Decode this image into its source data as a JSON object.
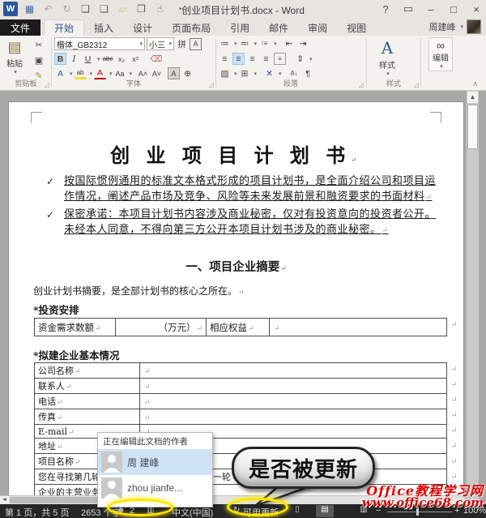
{
  "window": {
    "title": "创业项目计划书.docx - Word",
    "user_name": "周建峰",
    "help": "?"
  },
  "icons": {
    "word_logo": "W",
    "save": "▦",
    "undo": "↶",
    "redo": "↻",
    "quick_print": "❑",
    "new_doc": "❏",
    "open": "▱",
    "print_preview": "❒",
    "touch_mode": "☝",
    "ribbon_options": "▭",
    "minimize": "–",
    "restore": "□",
    "close": "×",
    "dropdown": "▾",
    "launcher": "◿",
    "collapse": "∧",
    "paste": "▤",
    "cut": "✂",
    "copy": "▣",
    "format_painter": "✎",
    "phonetic": "拼",
    "char_border": "A",
    "bold": "B",
    "italic": "I",
    "underline": "U",
    "strike": "abc",
    "subscript": "x₂",
    "superscript": "x²",
    "clear_format": "⌫",
    "text_effects": "A",
    "highlight": "ab",
    "font_color": "A",
    "change_case": "Aa",
    "grow_font": "A˄",
    "shrink_font": "A˅",
    "char_shading": "A",
    "enclose_char": "⊕",
    "bullets": "≔",
    "numbering": "≕",
    "multilevel": "⁝≡",
    "outdent": "⇤",
    "indent": "⇥",
    "align_left": "≡",
    "align_center": "≡",
    "align_right": "≡",
    "justify": "≡",
    "distribute": "≡",
    "line_spacing": "⇕",
    "shading": "▨",
    "borders": "⊞",
    "asian_layout": "✕",
    "sort": "A↓",
    "pilcrow": "¶",
    "styles_big": "A",
    "editing_binoculars": "∞",
    "people": "☻",
    "proofing": "▥",
    "update": "↻",
    "read_view": "▯",
    "print_layout_view": "▤",
    "web_view": "▥",
    "zoom_minus": "−",
    "zoom_plus": "+",
    "scroll_up": "▲",
    "scroll_left": "◄",
    "check_bullet": "✓"
  },
  "tabs": [
    {
      "label": "文件"
    },
    {
      "label": "开始"
    },
    {
      "label": "插入"
    },
    {
      "label": "设计"
    },
    {
      "label": "页面布局"
    },
    {
      "label": "引用"
    },
    {
      "label": "邮件"
    },
    {
      "label": "审阅"
    },
    {
      "label": "视图"
    }
  ],
  "ribbon": {
    "clipboard": {
      "paste": "粘贴",
      "label": "剪贴板"
    },
    "font": {
      "name": "楷体_GB2312",
      "size": "小三",
      "label": "字体"
    },
    "paragraph": {
      "label": "段落"
    },
    "styles": {
      "button": "样式",
      "label": "样式"
    },
    "editing": {
      "button": "编辑"
    }
  },
  "document": {
    "title": "创 业 项 目 计 划 书",
    "bullets": [
      {
        "text": "按国际惯例通用的标准文本格式形成的项目计划书，是全面介绍公司和项目运作情况，阐述产品市场及竞争、风险等未来发展前景和融资要求的书面材料"
      },
      {
        "text": "保密承诺：本项目计划书内容涉及商业秘密，仅对有投资意向的投资者公开。未经本人同意，不得向第三方公开本项目计划书涉及的商业秘密。"
      }
    ],
    "heading2": "一、项目企业摘要",
    "intro": "创业计划书摘要，是全部计划书的核心之所在。",
    "label_investment": "*投资安排",
    "investment_table": {
      "c1": "资金需求数额",
      "c2": "（万元）",
      "c3": "相应权益",
      "c4": ""
    },
    "label_company": "*拟建企业基本情况",
    "company_table": {
      "rows": [
        {
          "label": "公司名称",
          "value": ""
        },
        {
          "label": "联系人",
          "value": ""
        },
        {
          "label": "电话",
          "value": ""
        },
        {
          "label": "传真",
          "value": ""
        },
        {
          "label": "E-mail",
          "value": ""
        },
        {
          "label": "地址",
          "value": ""
        },
        {
          "label": "项目名称",
          "value": ""
        },
        {
          "label": "您在寻找第几轮资金",
          "value": "一轮"
        },
        {
          "label": "企业的主营业务",
          "value": ""
        }
      ]
    }
  },
  "authors_popup": {
    "title": "正在编辑此文档的作者",
    "authors": [
      {
        "name": "周 建峰"
      },
      {
        "name": "zhou jianfe..."
      }
    ]
  },
  "callout": {
    "text": "是否被更新"
  },
  "statusbar": {
    "page_info": "第 1 页，共 5 页",
    "word_count": "2653 个字",
    "authors_count": "2",
    "language": "中文(中国)",
    "update_label": "可用更新",
    "zoom_percent": "100%"
  },
  "watermark": {
    "line1": "Office教程学习网",
    "line2": "www.office68.com"
  },
  "colors": {
    "accent": "#2b579a",
    "annotation_yellow": "#ffe400",
    "statusbar_bg": "#262626",
    "watermark_red": "#e00000"
  }
}
